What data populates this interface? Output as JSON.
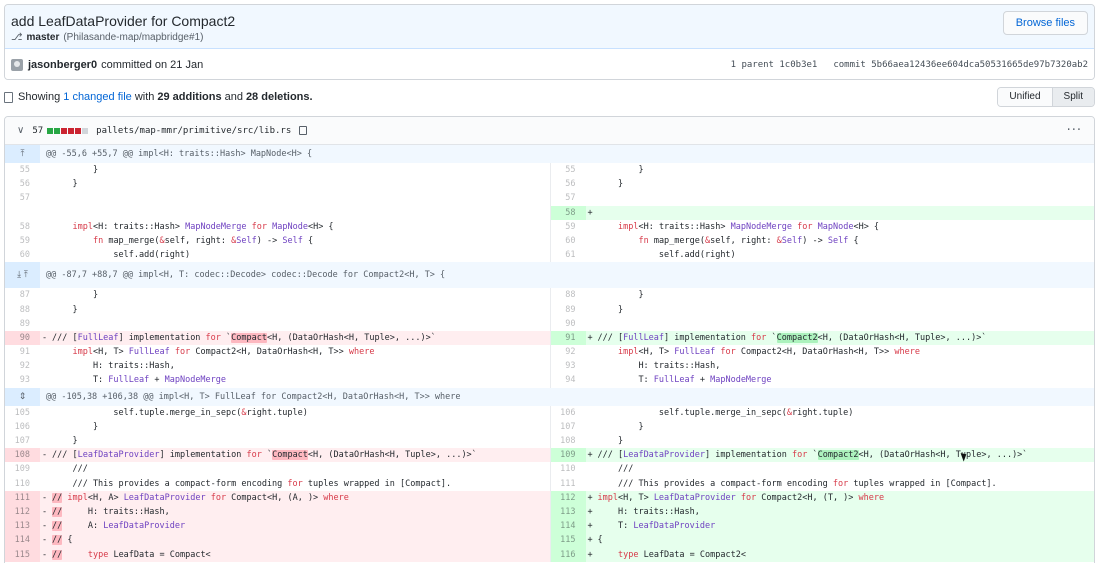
{
  "commit": {
    "title": "add LeafDataProvider for Compact2",
    "branch": "master",
    "pr_ref": "(Philasande-map/mapbridge#1)",
    "browse_label": "Browse files",
    "author": "jasonberger0",
    "committed_text": "committed on 21 Jan",
    "parents": "1 parent 1c0b3e1",
    "commit_hash": "commit 5b66aea12436ee604dca50531665de97b7320ab2"
  },
  "summary": {
    "showing": "Showing",
    "changed_file": "1 changed file",
    "with": "with",
    "additions": "29 additions",
    "and": "and",
    "deletions": "28 deletions.",
    "unified_label": "Unified",
    "split_label": "Split"
  },
  "file": {
    "change_count": "57",
    "path": "pallets/map-mmr/primitive/src/lib.rs",
    "diffstat_colors": [
      "#28a745",
      "#28a745",
      "#cb2431",
      "#cb2431",
      "#cb2431",
      "#d1d5da"
    ],
    "more_label": "···"
  },
  "hunks": [
    {
      "header": "@@ -55,6 +55,7 @@ impl<H: traits::Hash> MapNode<H> {",
      "expand_icon": "⤒",
      "tall": false,
      "rows": [
        {
          "l": {
            "n": "55",
            "t": "",
            "c": "        }"
          },
          "r": {
            "n": "55",
            "t": "",
            "c": "        }"
          }
        },
        {
          "l": {
            "n": "56",
            "t": "",
            "c": "    }"
          },
          "r": {
            "n": "56",
            "t": "",
            "c": "    }"
          }
        },
        {
          "l": {
            "n": "57",
            "t": "",
            "c": ""
          },
          "r": {
            "n": "57",
            "t": "",
            "c": ""
          }
        },
        {
          "l": {
            "n": "",
            "t": "empty",
            "c": ""
          },
          "r": {
            "n": "58",
            "t": "add",
            "c": ""
          }
        },
        {
          "l": {
            "n": "58",
            "t": "",
            "c": "    impl<H: traits::Hash> MapNodeMerge for MapNode<H> {"
          },
          "r": {
            "n": "59",
            "t": "",
            "c": "    impl<H: traits::Hash> MapNodeMerge for MapNode<H> {"
          }
        },
        {
          "l": {
            "n": "59",
            "t": "",
            "c": "        fn map_merge(&self, right: &Self) -> Self {"
          },
          "r": {
            "n": "60",
            "t": "",
            "c": "        fn map_merge(&self, right: &Self) -> Self {"
          }
        },
        {
          "l": {
            "n": "60",
            "t": "",
            "c": "            self.add(right)"
          },
          "r": {
            "n": "61",
            "t": "",
            "c": "            self.add(right)"
          }
        }
      ]
    },
    {
      "header": "@@ -87,7 +88,7 @@ impl<H, T: codec::Decode> codec::Decode for Compact2<H, T> {",
      "expand_icon": "⤓\n⤒",
      "tall": true,
      "rows": [
        {
          "l": {
            "n": "87",
            "t": "",
            "c": "        }"
          },
          "r": {
            "n": "88",
            "t": "",
            "c": "        }"
          }
        },
        {
          "l": {
            "n": "88",
            "t": "",
            "c": "    }"
          },
          "r": {
            "n": "89",
            "t": "",
            "c": "    }"
          }
        },
        {
          "l": {
            "n": "89",
            "t": "",
            "c": ""
          },
          "r": {
            "n": "90",
            "t": "",
            "c": ""
          }
        },
        {
          "l": {
            "n": "90",
            "t": "del",
            "c": "/// [FullLeaf] implementation for `",
            "hl": "Compact",
            "c2": "<H, (DataOrHash<H, Tuple>, ...)>`"
          },
          "r": {
            "n": "91",
            "t": "add",
            "c": "/// [FullLeaf] implementation for `",
            "hl": "Compact2",
            "c2": "<H, (DataOrHash<H, Tuple>, ...)>`"
          }
        },
        {
          "l": {
            "n": "91",
            "t": "",
            "c": "    impl<H, T> FullLeaf for Compact2<H, DataOrHash<H, T>> where"
          },
          "r": {
            "n": "92",
            "t": "",
            "c": "    impl<H, T> FullLeaf for Compact2<H, DataOrHash<H, T>> where"
          }
        },
        {
          "l": {
            "n": "92",
            "t": "",
            "c": "        H: traits::Hash,"
          },
          "r": {
            "n": "93",
            "t": "",
            "c": "        H: traits::Hash,"
          }
        },
        {
          "l": {
            "n": "93",
            "t": "",
            "c": "        T: FullLeaf + MapNodeMerge"
          },
          "r": {
            "n": "94",
            "t": "",
            "c": "        T: FullLeaf + MapNodeMerge"
          }
        }
      ]
    },
    {
      "header": "@@ -105,38 +106,38 @@ impl<H, T> FullLeaf for Compact2<H, DataOrHash<H, T>> where",
      "expand_icon": "⇕",
      "tall": false,
      "rows": [
        {
          "l": {
            "n": "105",
            "t": "",
            "c": "            self.tuple.merge_in_sepc(&right.tuple)"
          },
          "r": {
            "n": "106",
            "t": "",
            "c": "            self.tuple.merge_in_sepc(&right.tuple)"
          }
        },
        {
          "l": {
            "n": "106",
            "t": "",
            "c": "        }"
          },
          "r": {
            "n": "107",
            "t": "",
            "c": "        }"
          }
        },
        {
          "l": {
            "n": "107",
            "t": "",
            "c": "    }"
          },
          "r": {
            "n": "108",
            "t": "",
            "c": "    }"
          }
        },
        {
          "l": {
            "n": "108",
            "t": "del",
            "c": "/// [LeafDataProvider] implementation for `",
            "hl": "Compact",
            "c2": "<H, (DataOrHash<H, Tuple>, ...)>`"
          },
          "r": {
            "n": "109",
            "t": "add",
            "c": "/// [LeafDataProvider] implementation for `",
            "hl": "Compact2",
            "c2": "<H, (DataOrHash<H, Tuple>, ...)>`"
          }
        },
        {
          "l": {
            "n": "109",
            "t": "",
            "c": "    ///"
          },
          "r": {
            "n": "110",
            "t": "",
            "c": "    ///"
          }
        },
        {
          "l": {
            "n": "110",
            "t": "",
            "c": "    /// This provides a compact-form encoding for tuples wrapped in [Compact]."
          },
          "r": {
            "n": "111",
            "t": "",
            "c": "    /// This provides a compact-form encoding for tuples wrapped in [Compact]."
          }
        },
        {
          "l": {
            "n": "111",
            "t": "del",
            "c": "",
            "hl": "//",
            "c2": " impl<H, A> LeafDataProvider for Compact<H, (A, )> where"
          },
          "r": {
            "n": "112",
            "t": "add",
            "c": "impl<H, T> LeafDataProvider for Compact2<H, (T, )> where"
          }
        },
        {
          "l": {
            "n": "112",
            "t": "del",
            "c": "",
            "hl": "//",
            "c2": "     H: traits::Hash,"
          },
          "r": {
            "n": "113",
            "t": "add",
            "c": "    H: traits::Hash,"
          }
        },
        {
          "l": {
            "n": "113",
            "t": "del",
            "c": "",
            "hl": "//",
            "c2": "     A: LeafDataProvider"
          },
          "r": {
            "n": "114",
            "t": "add",
            "c": "    T: LeafDataProvider"
          }
        },
        {
          "l": {
            "n": "114",
            "t": "del",
            "c": "",
            "hl": "//",
            "c2": " {"
          },
          "r": {
            "n": "115",
            "t": "add",
            "c": "{"
          }
        },
        {
          "l": {
            "n": "115",
            "t": "del",
            "c": "",
            "hl": "//",
            "c2": "     type LeafData = Compact<"
          },
          "r": {
            "n": "116",
            "t": "add",
            "c": "    type LeafData = Compact2<"
          }
        }
      ]
    }
  ]
}
